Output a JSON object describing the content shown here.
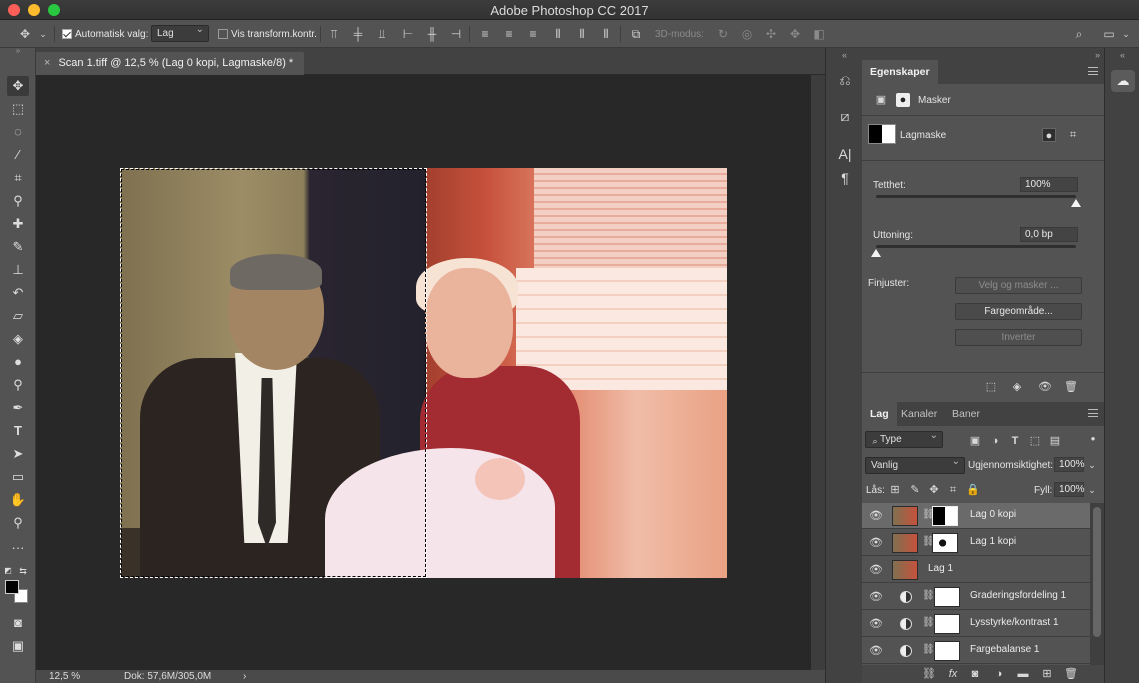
{
  "app": {
    "title": "Adobe Photoshop CC 2017"
  },
  "options_bar": {
    "auto_select_label": "Automatisk valg:",
    "auto_select_checked": true,
    "auto_select_value": "Lag",
    "transform_label": "Vis transform.kontr.",
    "transform_checked": false,
    "mode_3d_label": "3D-modus:"
  },
  "document": {
    "tab_title": "Scan 1.tiff @ 12,5 % (Lag 0 kopi, Lagmaske/8) *",
    "close_glyph": "×"
  },
  "status_bar": {
    "zoom": "12,5 %",
    "doc_size": "Dok: 57,6M/305,0M",
    "arrow": "›"
  },
  "properties_panel": {
    "tab_label": "Egenskaper",
    "section_label": "Masker",
    "mask_label": "Lagmaske",
    "density_label": "Tetthet:",
    "density_value": "100%",
    "density_level": 1.0,
    "feather_label": "Uttoning:",
    "feather_value": "0,0 bp",
    "feather_level": 0.0,
    "refine_label": "Finjuster:",
    "select_mask_button": "Velg og masker ...",
    "color_range_button": "Fargeområde...",
    "invert_button": "Inverter"
  },
  "layers_panel": {
    "tabs": [
      "Lag",
      "Kanaler",
      "Baner"
    ],
    "filter_type": "Type",
    "blend_mode": "Vanlig",
    "opacity_label": "Ugjennomsiktighet:",
    "opacity_value": "100%",
    "lock_label": "Lås:",
    "fill_label": "Fyll:",
    "fill_value": "100%",
    "layers": [
      {
        "name": "Lag 0 kopi",
        "selected": true,
        "has_mask": true
      },
      {
        "name": "Lag 1 kopi",
        "selected": false,
        "has_mask": true
      },
      {
        "name": "Lag 1",
        "selected": false,
        "has_mask": false
      },
      {
        "name": "Graderingsfordeling 1",
        "selected": false,
        "adjustment": true
      },
      {
        "name": "Lysstyrke/kontrast 1",
        "selected": false,
        "adjustment": true
      },
      {
        "name": "Fargebalanse 1",
        "selected": false,
        "adjustment": true
      }
    ]
  },
  "colors": {
    "foreground": "#000000",
    "background": "#ffffff",
    "panel": "#535353",
    "canvas_bg": "#282828"
  }
}
